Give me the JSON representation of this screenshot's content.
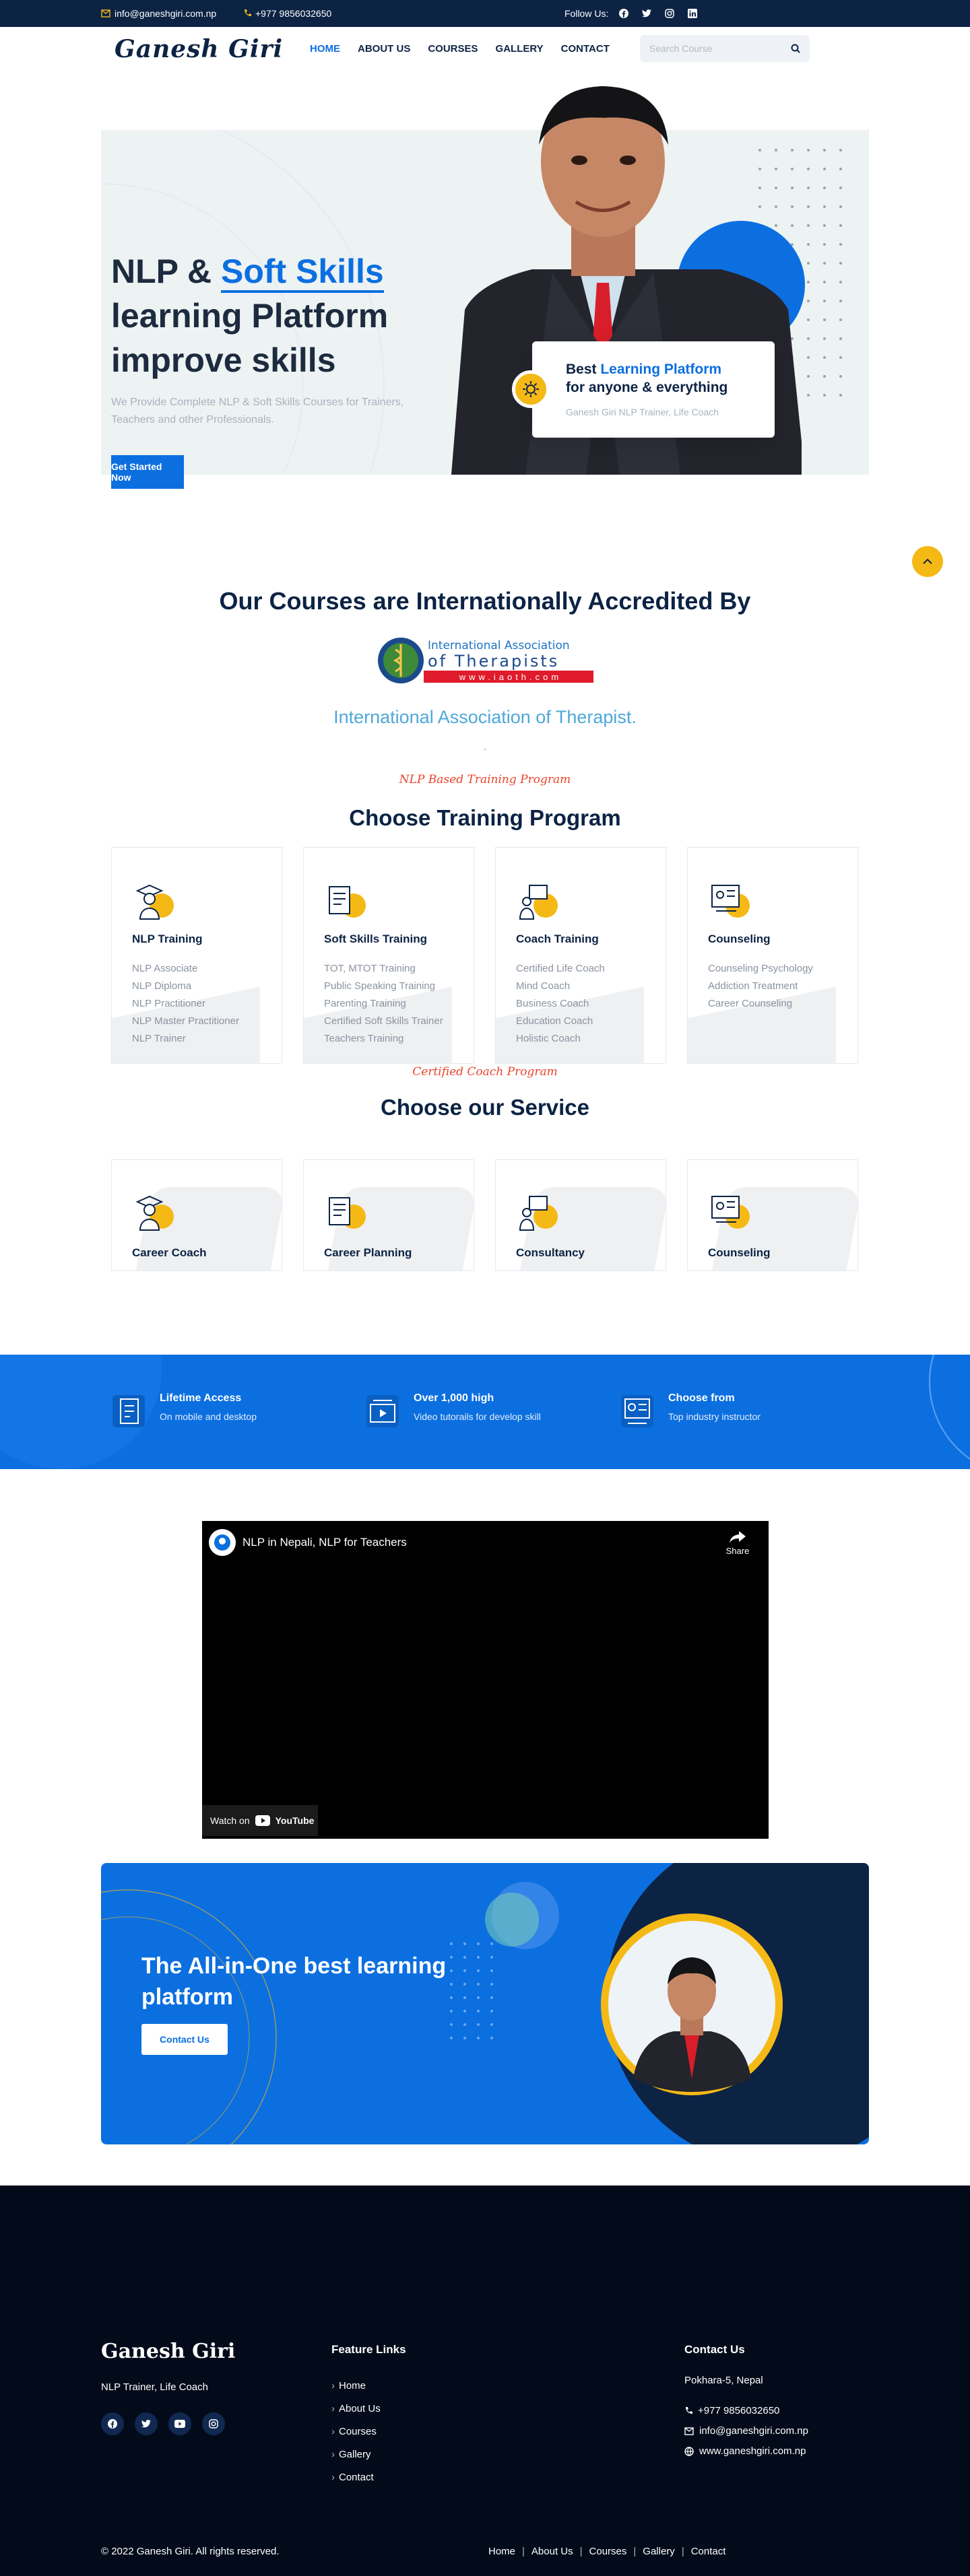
{
  "topbar": {
    "email": "info@ganeshgiri.com.np",
    "phone": "+977 9856032650",
    "follow_label": "Follow Us:"
  },
  "header": {
    "logo": "Ganesh Giri",
    "nav": [
      "HOME",
      "ABOUT US",
      "COURSES",
      "GALLERY",
      "CONTACT"
    ],
    "active_nav": "HOME",
    "search_placeholder": "Search Course"
  },
  "hero": {
    "title_prefix": "NLP & ",
    "title_highlight": "Soft Skills",
    "title_line2": "learning Platform",
    "title_line3": "improve skills",
    "description": "We Provide Complete NLP & Soft Skills Courses for Trainers, Teachers and other Professionals.",
    "cta": "Get Started Now",
    "card_best": "Best ",
    "card_highlight": "Learning Platform",
    "card_line2": "for anyone & everything",
    "card_sub": "Ganesh Giri NLP Trainer, Life Coach"
  },
  "accredited": {
    "title": "Our Courses are Internationally Accredited By",
    "logo_line1": "International Association",
    "logo_line2": "of Therapists",
    "logo_url": "www.iaoth.com",
    "name": "International Association of Therapist."
  },
  "training": {
    "script": "NLP Based Training Program",
    "title": "Choose Training Program",
    "cards": [
      {
        "title": "NLP Training",
        "items": [
          "NLP Associate",
          "NLP Diploma",
          "NLP Practitioner",
          "NLP Master Practitioner",
          "NLP Trainer"
        ]
      },
      {
        "title": "Soft Skills Training",
        "items": [
          "TOT, MTOT Training",
          "Public Speaking Training",
          "Parenting Training",
          "Certified Soft Skills Trainer",
          "Teachers Training"
        ]
      },
      {
        "title": "Coach Training",
        "items": [
          "Certified Life Coach",
          "Mind Coach",
          "Business Coach",
          "Education Coach",
          "Holistic Coach"
        ]
      },
      {
        "title": "Counseling",
        "items": [
          "Counseling Psychology",
          "Addiction Treatment",
          "Career Counseling"
        ]
      }
    ]
  },
  "services": {
    "script": "Certified Coach Program",
    "title": "Choose our Service",
    "cards": [
      "Career Coach",
      "Career Planning",
      "Consultancy",
      "Counseling"
    ]
  },
  "features": [
    {
      "title": "Lifetime Access",
      "sub": "On mobile and desktop"
    },
    {
      "title": "Over 1,000 high",
      "sub": "Video tutorails for develop skill"
    },
    {
      "title": "Choose from",
      "sub": "Top industry instructor"
    }
  ],
  "video": {
    "title": "NLP in Nepali, NLP for Teachers",
    "share": "Share",
    "watch_on": "Watch on",
    "youtube": "YouTube"
  },
  "cta": {
    "title_line1": "The All-in-One best learning",
    "title_line2": "platform",
    "button": "Contact Us"
  },
  "footer": {
    "logo": "Ganesh Giri",
    "subtitle": "NLP Trainer, Life Coach",
    "links_title": "Feature Links",
    "links": [
      "Home",
      "About Us",
      "Courses",
      "Gallery",
      "Contact"
    ],
    "contact_title": "Contact Us",
    "address": "Pokhara-5, Nepal",
    "phone": "+977 9856032650",
    "email": "info@ganeshgiri.com.np",
    "website": "www.ganeshgiri.com.np",
    "copyright": "© 2022 Ganesh Giri. All rights reserved.",
    "bottom_nav": [
      "Home",
      "About Us",
      "Courses",
      "Gallery",
      "Contact"
    ]
  },
  "colors": {
    "primary": "#0c6fe0",
    "navy": "#0c2344",
    "accent": "#f5b916",
    "footer": "#030b1a"
  }
}
